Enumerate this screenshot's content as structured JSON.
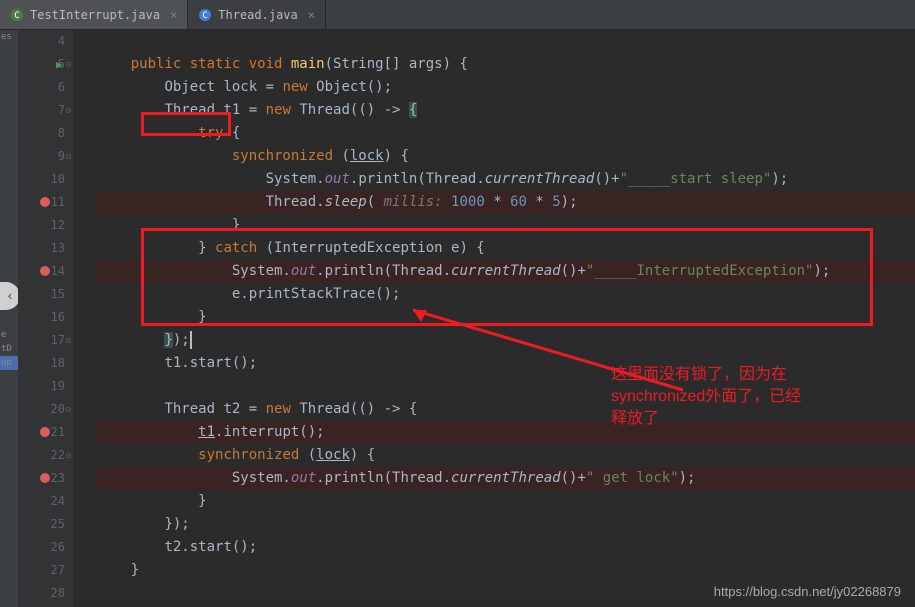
{
  "tabs": [
    {
      "label": "TestInterrupt.java",
      "active": true
    },
    {
      "label": "Thread.java",
      "active": false
    }
  ],
  "gutter_start": 4,
  "breakpoints": [
    11,
    14,
    21,
    23
  ],
  "run_marker_line": 5,
  "code": {
    "l4": "",
    "l5_p1": "public static void ",
    "l5_method": "main",
    "l5_p2": "(String[] args) {",
    "l6_p1": "Object lock = ",
    "l6_kw": "new ",
    "l6_p2": "Object();",
    "l7_p1": "Thread t1 = ",
    "l7_kw": "new ",
    "l7_p2": "Thread(() -> ",
    "l7_hl": "{",
    "l8_kw": "try ",
    "l8_p": "{",
    "l9_kw": "synchronized ",
    "l9_p1": "(",
    "l9_lock": "lock",
    "l9_p2": ") {",
    "l10_p1": "System.",
    "l10_out": "out",
    "l10_p2": ".println(Thread.",
    "l10_ct": "currentThread",
    "l10_p3": "()+",
    "l10_str": "\"_____start sleep\"",
    "l10_p4": ");",
    "l11_p1": "Thread.",
    "l11_sleep": "sleep",
    "l11_p2": "( ",
    "l11_hint": "millis: ",
    "l11_n1": "1000 ",
    "l11_op1": "* ",
    "l11_n2": "60 ",
    "l11_op2": "* ",
    "l11_n3": "5",
    "l11_p3": ");",
    "l12": "}",
    "l13_p1": "} ",
    "l13_kw": "catch ",
    "l13_p2": "(InterruptedException e) {",
    "l14_p1": "System.",
    "l14_out": "out",
    "l14_p2": ".println(Thread.",
    "l14_ct": "currentThread",
    "l14_p3": "()+",
    "l14_str": "\"_____InterruptedException\"",
    "l14_p4": ");",
    "l15": "e.printStackTrace();",
    "l16": "}",
    "l17_p1": "}",
    "l17_p2": ");",
    "l18": "t1.start();",
    "l19": "",
    "l20_p1": "Thread t2 = ",
    "l20_kw": "new ",
    "l20_p2": "Thread(() -> {",
    "l21_t1": "t1",
    "l21_p": ".interrupt();",
    "l22_kw": "synchronized ",
    "l22_p1": "(",
    "l22_lock": "lock",
    "l22_p2": ") {",
    "l23_p1": "System.",
    "l23_out": "out",
    "l23_p2": ".println(Thread.",
    "l23_ct": "currentThread",
    "l23_p3": "()+",
    "l23_str": "\" get lock\"",
    "l23_p4": ");",
    "l24": "}",
    "l25": "});",
    "l26": "t2.start();",
    "l27": "}",
    "l28": ""
  },
  "annotation": {
    "text1": "这里面没有锁了，因为在",
    "text2": "synchronized外面了，已经",
    "text3": "释放了"
  },
  "watermark": "https://blog.csdn.net/jy02268879"
}
